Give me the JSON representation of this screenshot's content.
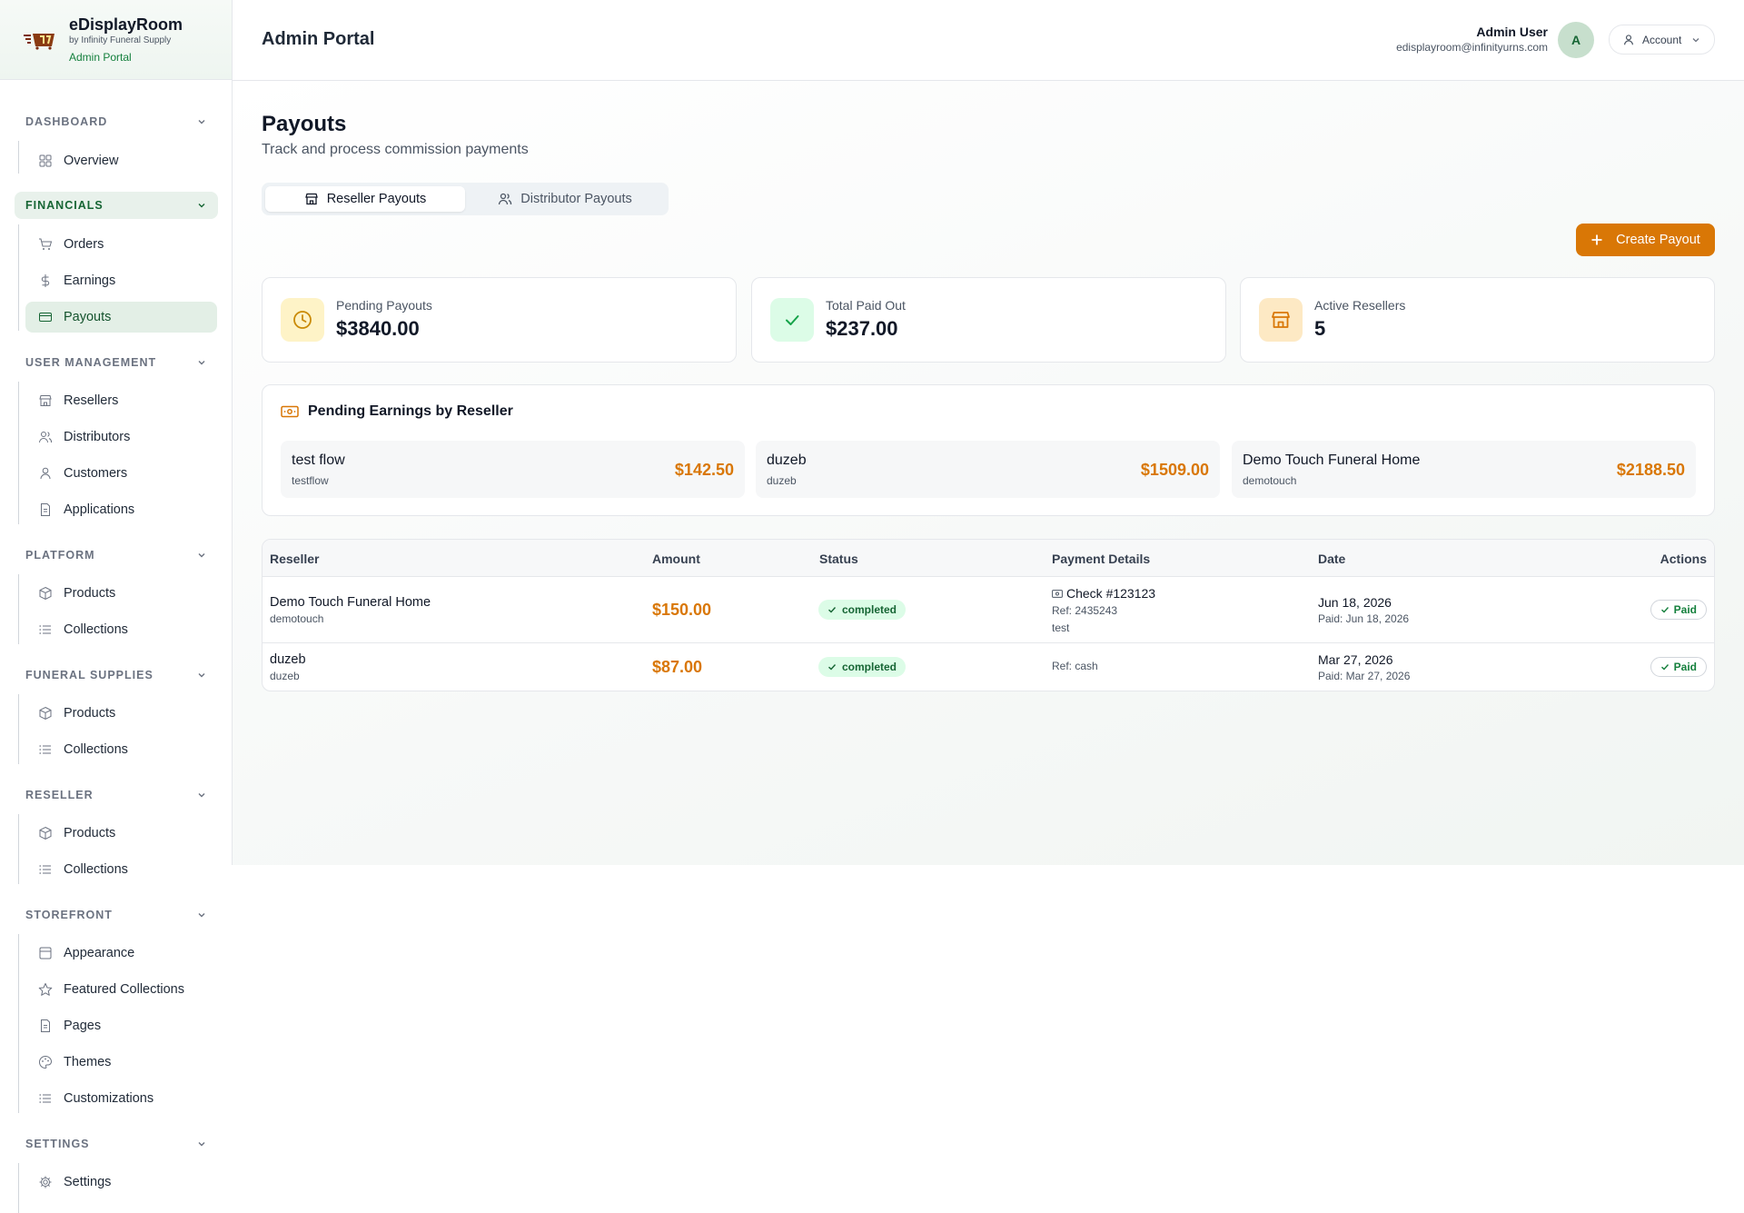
{
  "brand": {
    "name": "eDisplayRoom",
    "byline": "by Infinity Funeral Supply",
    "portal": "Admin Portal"
  },
  "sidebar": {
    "groups": [
      {
        "title": "DASHBOARD",
        "items": [
          {
            "label": "Overview",
            "icon": "grid-icon"
          }
        ]
      },
      {
        "title": "FINANCIALS",
        "items": [
          {
            "label": "Orders",
            "icon": "cart-icon"
          },
          {
            "label": "Earnings",
            "icon": "dollar-icon"
          },
          {
            "label": "Payouts",
            "icon": "credit-card-icon"
          }
        ]
      },
      {
        "title": "USER MANAGEMENT",
        "items": [
          {
            "label": "Resellers",
            "icon": "store-icon"
          },
          {
            "label": "Distributors",
            "icon": "users-icon"
          },
          {
            "label": "Customers",
            "icon": "user-icon"
          },
          {
            "label": "Applications",
            "icon": "file-icon"
          }
        ]
      },
      {
        "title": "PLATFORM",
        "items": [
          {
            "label": "Products",
            "icon": "package-icon"
          },
          {
            "label": "Collections",
            "icon": "list-icon"
          }
        ]
      },
      {
        "title": "FUNERAL SUPPLIES",
        "items": [
          {
            "label": "Products",
            "icon": "package-icon"
          },
          {
            "label": "Collections",
            "icon": "list-icon"
          }
        ]
      },
      {
        "title": "RESELLER",
        "items": [
          {
            "label": "Products",
            "icon": "package-icon"
          },
          {
            "label": "Collections",
            "icon": "list-icon"
          }
        ]
      },
      {
        "title": "STOREFRONT",
        "items": [
          {
            "label": "Appearance",
            "icon": "layout-icon"
          },
          {
            "label": "Featured Collections",
            "icon": "star-icon"
          },
          {
            "label": "Pages",
            "icon": "file-icon"
          },
          {
            "label": "Themes",
            "icon": "palette-icon"
          },
          {
            "label": "Customizations",
            "icon": "list-icon"
          }
        ]
      },
      {
        "title": "SETTINGS",
        "items": [
          {
            "label": "Settings",
            "icon": "gear-icon"
          }
        ]
      }
    ],
    "active_group": "FINANCIALS",
    "active_item": "Payouts"
  },
  "header": {
    "title": "Admin Portal",
    "user_name": "Admin User",
    "user_email": "edisplayroom@infinityurns.com",
    "avatar_initial": "A",
    "account_label": "Account"
  },
  "page": {
    "title": "Payouts",
    "subtitle": "Track and process commission payments",
    "tabs": [
      {
        "label": "Reseller Payouts",
        "icon": "store-icon",
        "active": true
      },
      {
        "label": "Distributor Payouts",
        "icon": "users-icon",
        "active": false
      }
    ],
    "create_button": "Create Payout"
  },
  "stats": [
    {
      "label": "Pending Payouts",
      "value": "$3840.00",
      "icon": "clock-icon",
      "color": "#ca8a04",
      "bg": "#fef3c7"
    },
    {
      "label": "Total Paid Out",
      "value": "$237.00",
      "icon": "check-icon",
      "color": "#16a34a",
      "bg": "#dcfce7"
    },
    {
      "label": "Active Resellers",
      "value": "5",
      "icon": "store-icon",
      "color": "#d97706",
      "bg": "#fde9c4"
    }
  ],
  "pending_earnings": {
    "title": "Pending Earnings by Reseller",
    "items": [
      {
        "name": "test flow",
        "username": "testflow",
        "amount": "$142.50"
      },
      {
        "name": "duzeb",
        "username": "duzeb",
        "amount": "$1509.00"
      },
      {
        "name": "Demo Touch Funeral Home",
        "username": "demotouch",
        "amount": "$2188.50"
      }
    ]
  },
  "table": {
    "columns": [
      "Reseller",
      "Amount",
      "Status",
      "Payment Details",
      "Date",
      "Actions"
    ],
    "rows": [
      {
        "name": "Demo Touch Funeral Home",
        "username": "demotouch",
        "amount": "$150.00",
        "status": "completed",
        "payment_method": "Check #123123",
        "ref": "Ref: 2435243",
        "note": "test",
        "date": "Jun 18, 2026",
        "paid_date": "Paid: Jun 18, 2026",
        "action": "Paid"
      },
      {
        "name": "duzeb",
        "username": "duzeb",
        "amount": "$87.00",
        "status": "completed",
        "payment_method": "",
        "ref": "Ref: cash",
        "note": "",
        "date": "Mar 27, 2026",
        "paid_date": "Paid: Mar 27, 2026",
        "action": "Paid"
      }
    ]
  }
}
